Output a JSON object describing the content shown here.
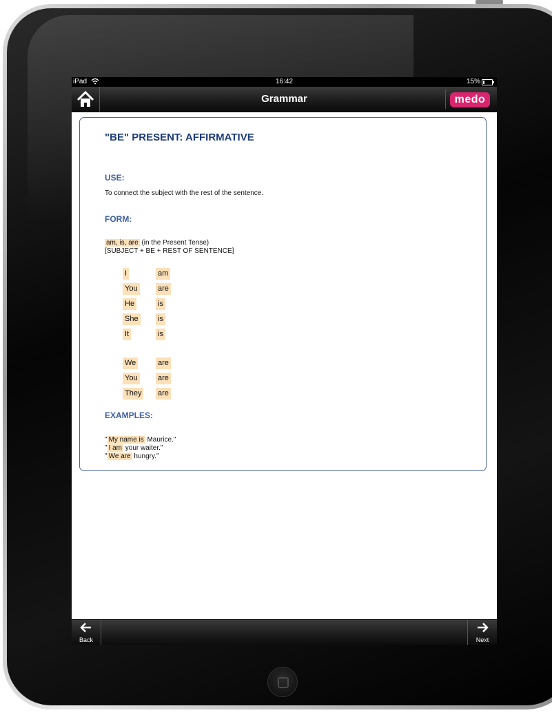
{
  "status": {
    "carrier": "iPad",
    "time": "16:42",
    "battery": "15%"
  },
  "nav": {
    "title": "Grammar",
    "logo_text": "medo"
  },
  "content": {
    "title": "\"BE\" PRESENT: AFFIRMATIVE",
    "use_heading": "USE:",
    "use_text": "To connect the subject with the rest of the sentence.",
    "form_heading": "FORM:",
    "form_highlight": "am, is, are",
    "form_note": "(in the Present Tense)",
    "form_formula": "[SUBJECT + BE + REST OF SENTENCE]",
    "conjugation": [
      {
        "subject": "I",
        "verb": "am"
      },
      {
        "subject": "You",
        "verb": "are"
      },
      {
        "subject": "He",
        "verb": "is"
      },
      {
        "subject": "She",
        "verb": "is"
      },
      {
        "subject": "It",
        "verb": "is"
      },
      {
        "subject": "We",
        "verb": "are"
      },
      {
        "subject": "You",
        "verb": "are"
      },
      {
        "subject": "They",
        "verb": "are"
      }
    ],
    "examples_heading": "EXAMPLES:",
    "examples": [
      {
        "open": "\"",
        "highlight": "My name is",
        "rest": " Maurice.\""
      },
      {
        "open": "\"",
        "highlight": "I am",
        "rest": " your waiter.\""
      },
      {
        "open": "\"",
        "highlight": "We are",
        "rest": " hungry.\""
      }
    ]
  },
  "toolbar": {
    "back_label": "Back",
    "next_label": "Next"
  },
  "icons": {
    "home": "home-icon",
    "wifi": "wifi-icon",
    "battery": "battery-icon",
    "back": "arrow-left-icon",
    "next": "arrow-right-icon"
  },
  "colors": {
    "heading_blue": "#3d5fa3",
    "title_blue": "#1c3a78",
    "highlight": "#fbe0b8",
    "logo_pink": "#d8256d"
  }
}
